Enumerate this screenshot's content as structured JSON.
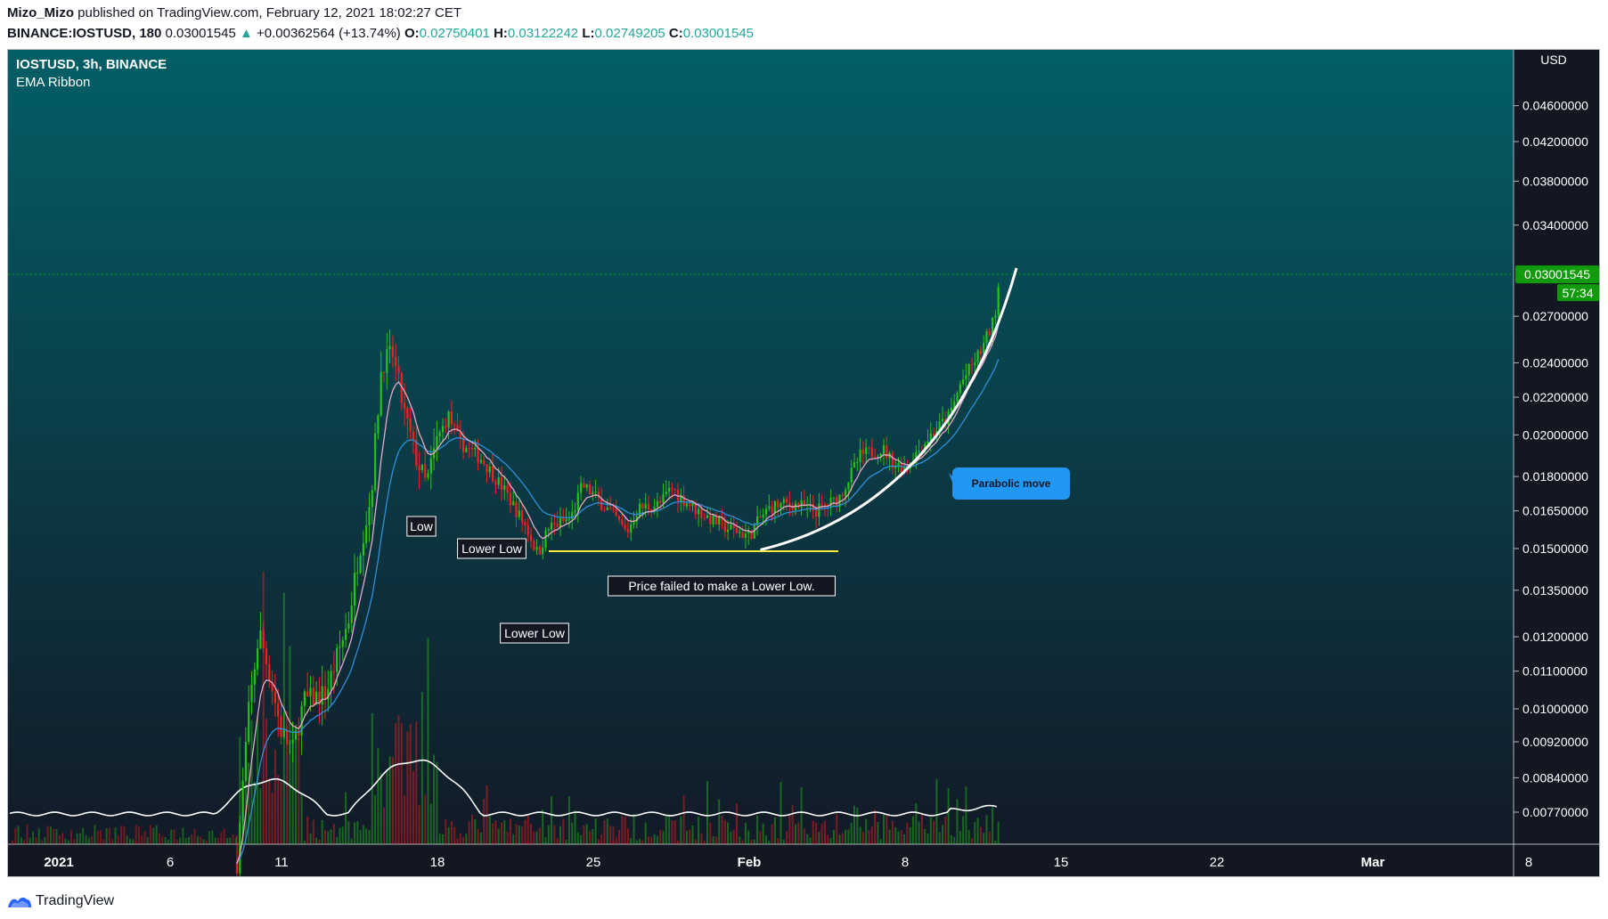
{
  "header": {
    "author": "Mizo_Mizo",
    "published_text": "published on TradingView.com, February 12, 2021 18:02:27 CET",
    "symbol": "BINANCE:IOSTUSD, 180",
    "last": "0.03001545",
    "change_arrow": "▲",
    "change": "+0.00362564 (+13.74%)",
    "o_label": "O:",
    "o": "0.02750401",
    "h_label": "H:",
    "h": "0.03122242",
    "l_label": "L:",
    "l": "0.02749205",
    "c_label": "C:",
    "c": "0.03001545"
  },
  "legend": {
    "title": "IOSTUSD, 3h, BINANCE",
    "indicator": "EMA Ribbon"
  },
  "price_axis": {
    "currency": "USD",
    "last_price_label": "0.03001545",
    "countdown": "57:34"
  },
  "footer": {
    "brand": "TradingView",
    "logo_icon": "tradingview-logo-icon"
  },
  "colors": {
    "up": "#26c21a",
    "down": "#ff1c1c",
    "ema_fast": "#e8a8c8",
    "ema_slow": "#2f8fd8",
    "volume_ma": "#ffffff",
    "support_line": "#ffeb3b",
    "arc": "#ffffff",
    "callout": "#2196f3",
    "last_price": "#119b0c",
    "bg_top": "#035e66",
    "bg_bottom": "#121a27"
  },
  "chart_data": {
    "type": "candlestick",
    "x_ticks": [
      {
        "label": "2021",
        "date": "2021-01-01"
      },
      {
        "label": "6",
        "date": "2021-01-06"
      },
      {
        "label": "11",
        "date": "2021-01-11"
      },
      {
        "label": "18",
        "date": "2021-01-18"
      },
      {
        "label": "25",
        "date": "2021-01-25"
      },
      {
        "label": "Feb",
        "date": "2021-02-01"
      },
      {
        "label": "8",
        "date": "2021-02-08"
      },
      {
        "label": "15",
        "date": "2021-02-15"
      },
      {
        "label": "22",
        "date": "2021-02-22"
      },
      {
        "label": "Mar",
        "date": "2021-03-01"
      },
      {
        "label": "8",
        "date": "2021-03-08"
      }
    ],
    "y_scale": "log",
    "y_ticks": [
      "0.04600000",
      "0.04200000",
      "0.03800000",
      "0.03400000",
      "0.02700000",
      "0.02400000",
      "0.02200000",
      "0.02000000",
      "0.01800000",
      "0.01650000",
      "0.01500000",
      "0.01350000",
      "0.01200000",
      "0.01100000",
      "0.01000000",
      "0.00920000",
      "0.00840000",
      "0.00770000"
    ],
    "y_range": [
      0.0071,
      0.0525
    ],
    "last_price": 0.03001545,
    "price_path": [
      [
        "2021-01-09",
        0.0068
      ],
      [
        "2021-01-09T12",
        0.0098
      ],
      [
        "2021-01-10",
        0.0122
      ],
      [
        "2021-01-10T12",
        0.0108
      ],
      [
        "2021-01-11",
        0.0094
      ],
      [
        "2021-01-11T12",
        0.009
      ],
      [
        "2021-01-12",
        0.0102
      ],
      [
        "2021-01-13",
        0.0104
      ],
      [
        "2021-01-14",
        0.0125
      ],
      [
        "2021-01-14T12",
        0.015
      ],
      [
        "2021-01-15",
        0.017
      ],
      [
        "2021-01-15T12",
        0.024
      ],
      [
        "2021-01-16",
        0.0245
      ],
      [
        "2021-01-16T12",
        0.0212
      ],
      [
        "2021-01-17",
        0.019
      ],
      [
        "2021-01-17T12",
        0.0176
      ],
      [
        "2021-01-18",
        0.0198
      ],
      [
        "2021-01-18T12",
        0.021
      ],
      [
        "2021-01-19",
        0.0196
      ],
      [
        "2021-01-20",
        0.0188
      ],
      [
        "2021-01-21",
        0.0174
      ],
      [
        "2021-01-22",
        0.0158
      ],
      [
        "2021-01-22T12",
        0.0148
      ],
      [
        "2021-01-23",
        0.0158
      ],
      [
        "2021-01-24",
        0.0162
      ],
      [
        "2021-01-24T12",
        0.0176
      ],
      [
        "2021-01-25",
        0.0172
      ],
      [
        "2021-01-26",
        0.0162
      ],
      [
        "2021-01-26T12",
        0.0156
      ],
      [
        "2021-01-27",
        0.0166
      ],
      [
        "2021-01-28",
        0.0168
      ],
      [
        "2021-01-28T12",
        0.0175
      ],
      [
        "2021-01-29",
        0.017
      ],
      [
        "2021-01-30",
        0.0163
      ],
      [
        "2021-01-31",
        0.0158
      ],
      [
        "2021-02-01",
        0.0155
      ],
      [
        "2021-02-01T12",
        0.0162
      ],
      [
        "2021-02-02",
        0.0167
      ],
      [
        "2021-02-03",
        0.0168
      ],
      [
        "2021-02-04",
        0.0165
      ],
      [
        "2021-02-05",
        0.017
      ],
      [
        "2021-02-06",
        0.019
      ],
      [
        "2021-02-07",
        0.0193
      ],
      [
        "2021-02-07T12",
        0.0186
      ],
      [
        "2021-02-08",
        0.0184
      ],
      [
        "2021-02-09",
        0.0198
      ],
      [
        "2021-02-10",
        0.021
      ],
      [
        "2021-02-10T12",
        0.0228
      ],
      [
        "2021-02-11",
        0.0238
      ],
      [
        "2021-02-11T12",
        0.025
      ],
      [
        "2021-02-12",
        0.0268
      ],
      [
        "2021-02-12T06",
        0.03
      ]
    ],
    "annotations": [
      {
        "id": "low",
        "text": "Low"
      },
      {
        "id": "lower-low-1",
        "text": "Lower Low"
      },
      {
        "id": "lower-low-2",
        "text": "Lower Low"
      },
      {
        "id": "failed",
        "text": "Price failed to make a Lower Low."
      },
      {
        "id": "parabolic",
        "text": "Parabolic move"
      }
    ],
    "support_level": 0.0149
  }
}
